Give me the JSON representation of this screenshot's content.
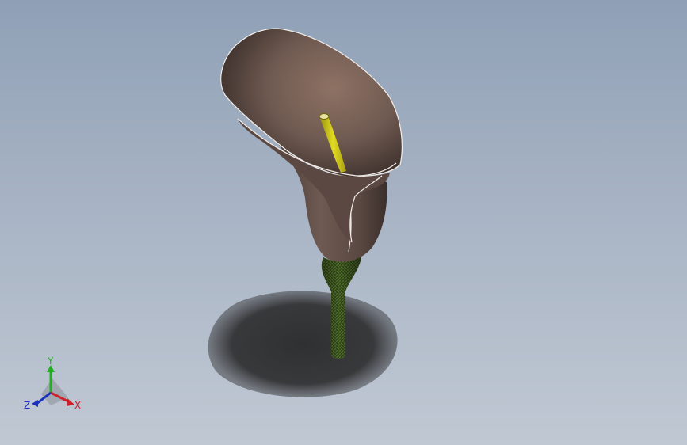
{
  "viewport": {
    "model": "calla-lily",
    "colors": {
      "background_top": "#8fa0b6",
      "background_bottom": "#c0c8d3",
      "spathe": "#6e5a52",
      "spathe_inner": "#8a6e62",
      "spadix": "#d4cc1a",
      "stem": "#3f5a22",
      "shadow": "#333436"
    }
  },
  "triad": {
    "x_label": "X",
    "y_label": "Y",
    "z_label": "Z",
    "x_color": "#d0202a",
    "y_color": "#22b020",
    "z_color": "#1a30c0"
  }
}
